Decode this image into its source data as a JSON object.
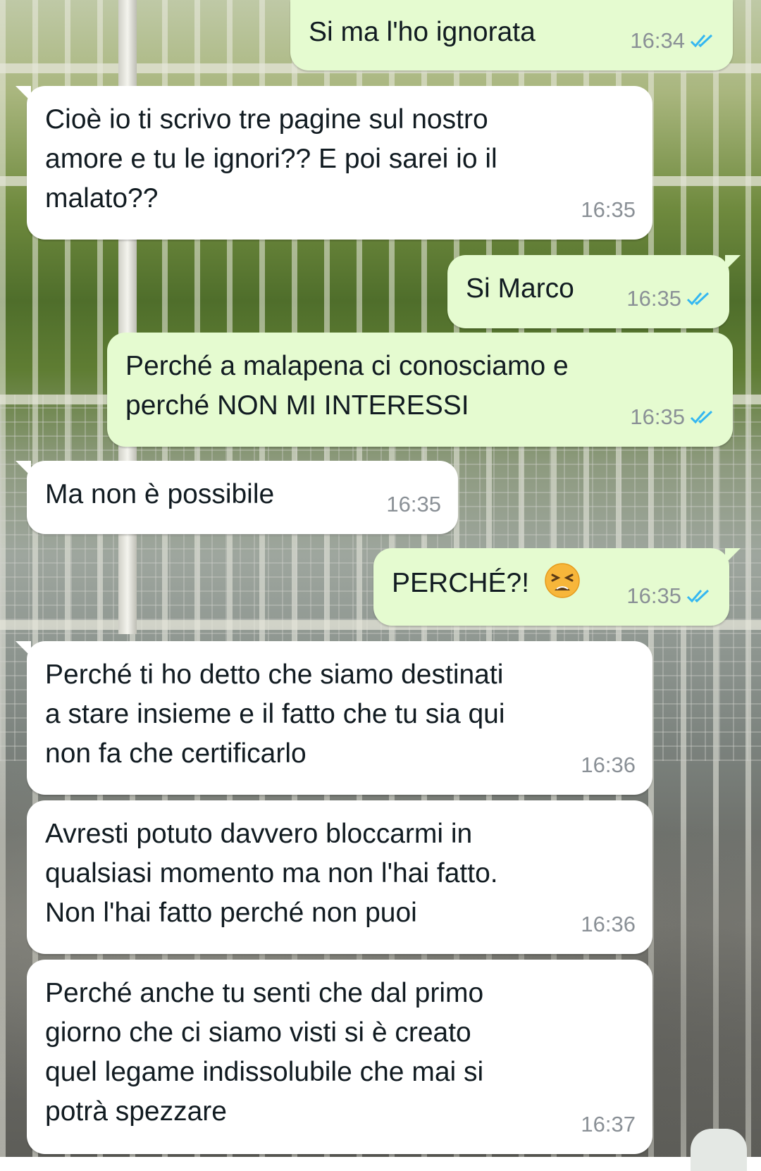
{
  "colors": {
    "incoming_bubble": "#ffffff",
    "outgoing_bubble": "#e5fbd0",
    "read_ticks": "#34b7f1",
    "timestamp": "#8a9096"
  },
  "messages": [
    {
      "direction": "out",
      "text": "Si ma l'ho ignorata",
      "time": "16:34",
      "status": "read"
    },
    {
      "direction": "in",
      "text": "Cioè io ti scrivo tre pagine sul nostro\namore e tu le ignori?? E poi sarei io il\nmalato??",
      "time": "16:35"
    },
    {
      "direction": "out",
      "text": "Si Marco",
      "time": "16:35",
      "status": "read"
    },
    {
      "direction": "out",
      "text": "Perché a malapena ci conosciamo e\nperché NON MI INTERESSI",
      "time": "16:35",
      "status": "read"
    },
    {
      "direction": "in",
      "text": "Ma non è possibile",
      "time": "16:35"
    },
    {
      "direction": "out",
      "text": "PERCHÉ?!",
      "time": "16:35",
      "status": "read",
      "emoji": "tired-face-emoji"
    },
    {
      "direction": "in",
      "text": "Perché ti ho detto che siamo destinati\na stare insieme e il fatto che tu sia qui\nnon fa che certificarlo",
      "time": "16:36"
    },
    {
      "direction": "in",
      "text": "Avresti potuto davvero bloccarmi in\nqualsiasi momento ma non l'hai fatto.\nNon l'hai fatto perché non puoi",
      "time": "16:36"
    },
    {
      "direction": "in",
      "text": "Perché anche tu senti che dal primo\ngiorno che ci siamo visti si è creato\nquel legame indissolubile che mai si\npotrà spezzare",
      "time": "16:37"
    }
  ]
}
